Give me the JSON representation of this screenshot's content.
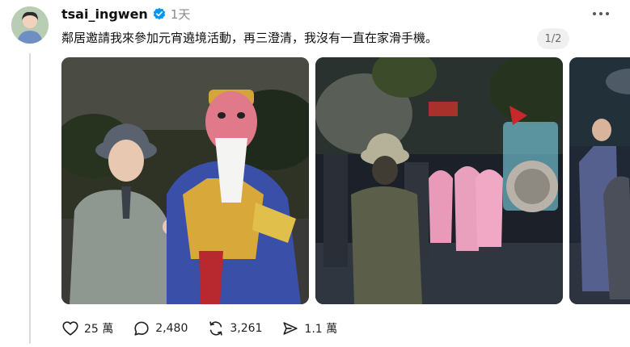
{
  "post": {
    "username": "tsai_ingwen",
    "verified": true,
    "time": "1天",
    "caption": "鄰居邀請我來參加元宵遶境活動，再三澄清，我沒有一直在家滑手機。",
    "pager": "1/2",
    "images": [
      {
        "name": "photo-woman-with-deity-puppet"
      },
      {
        "name": "photo-night-procession"
      },
      {
        "name": "photo-procession-partial"
      }
    ],
    "actions": {
      "likes": "25 萬",
      "comments": "2,480",
      "reposts": "3,261",
      "shares": "1.1 萬"
    }
  },
  "colors": {
    "verified_blue": "#0095f6",
    "text_secondary": "#8a8a8a"
  },
  "icons": [
    "verified-badge-icon",
    "more-options-icon",
    "heart-icon",
    "comment-icon",
    "repost-icon",
    "share-icon"
  ]
}
